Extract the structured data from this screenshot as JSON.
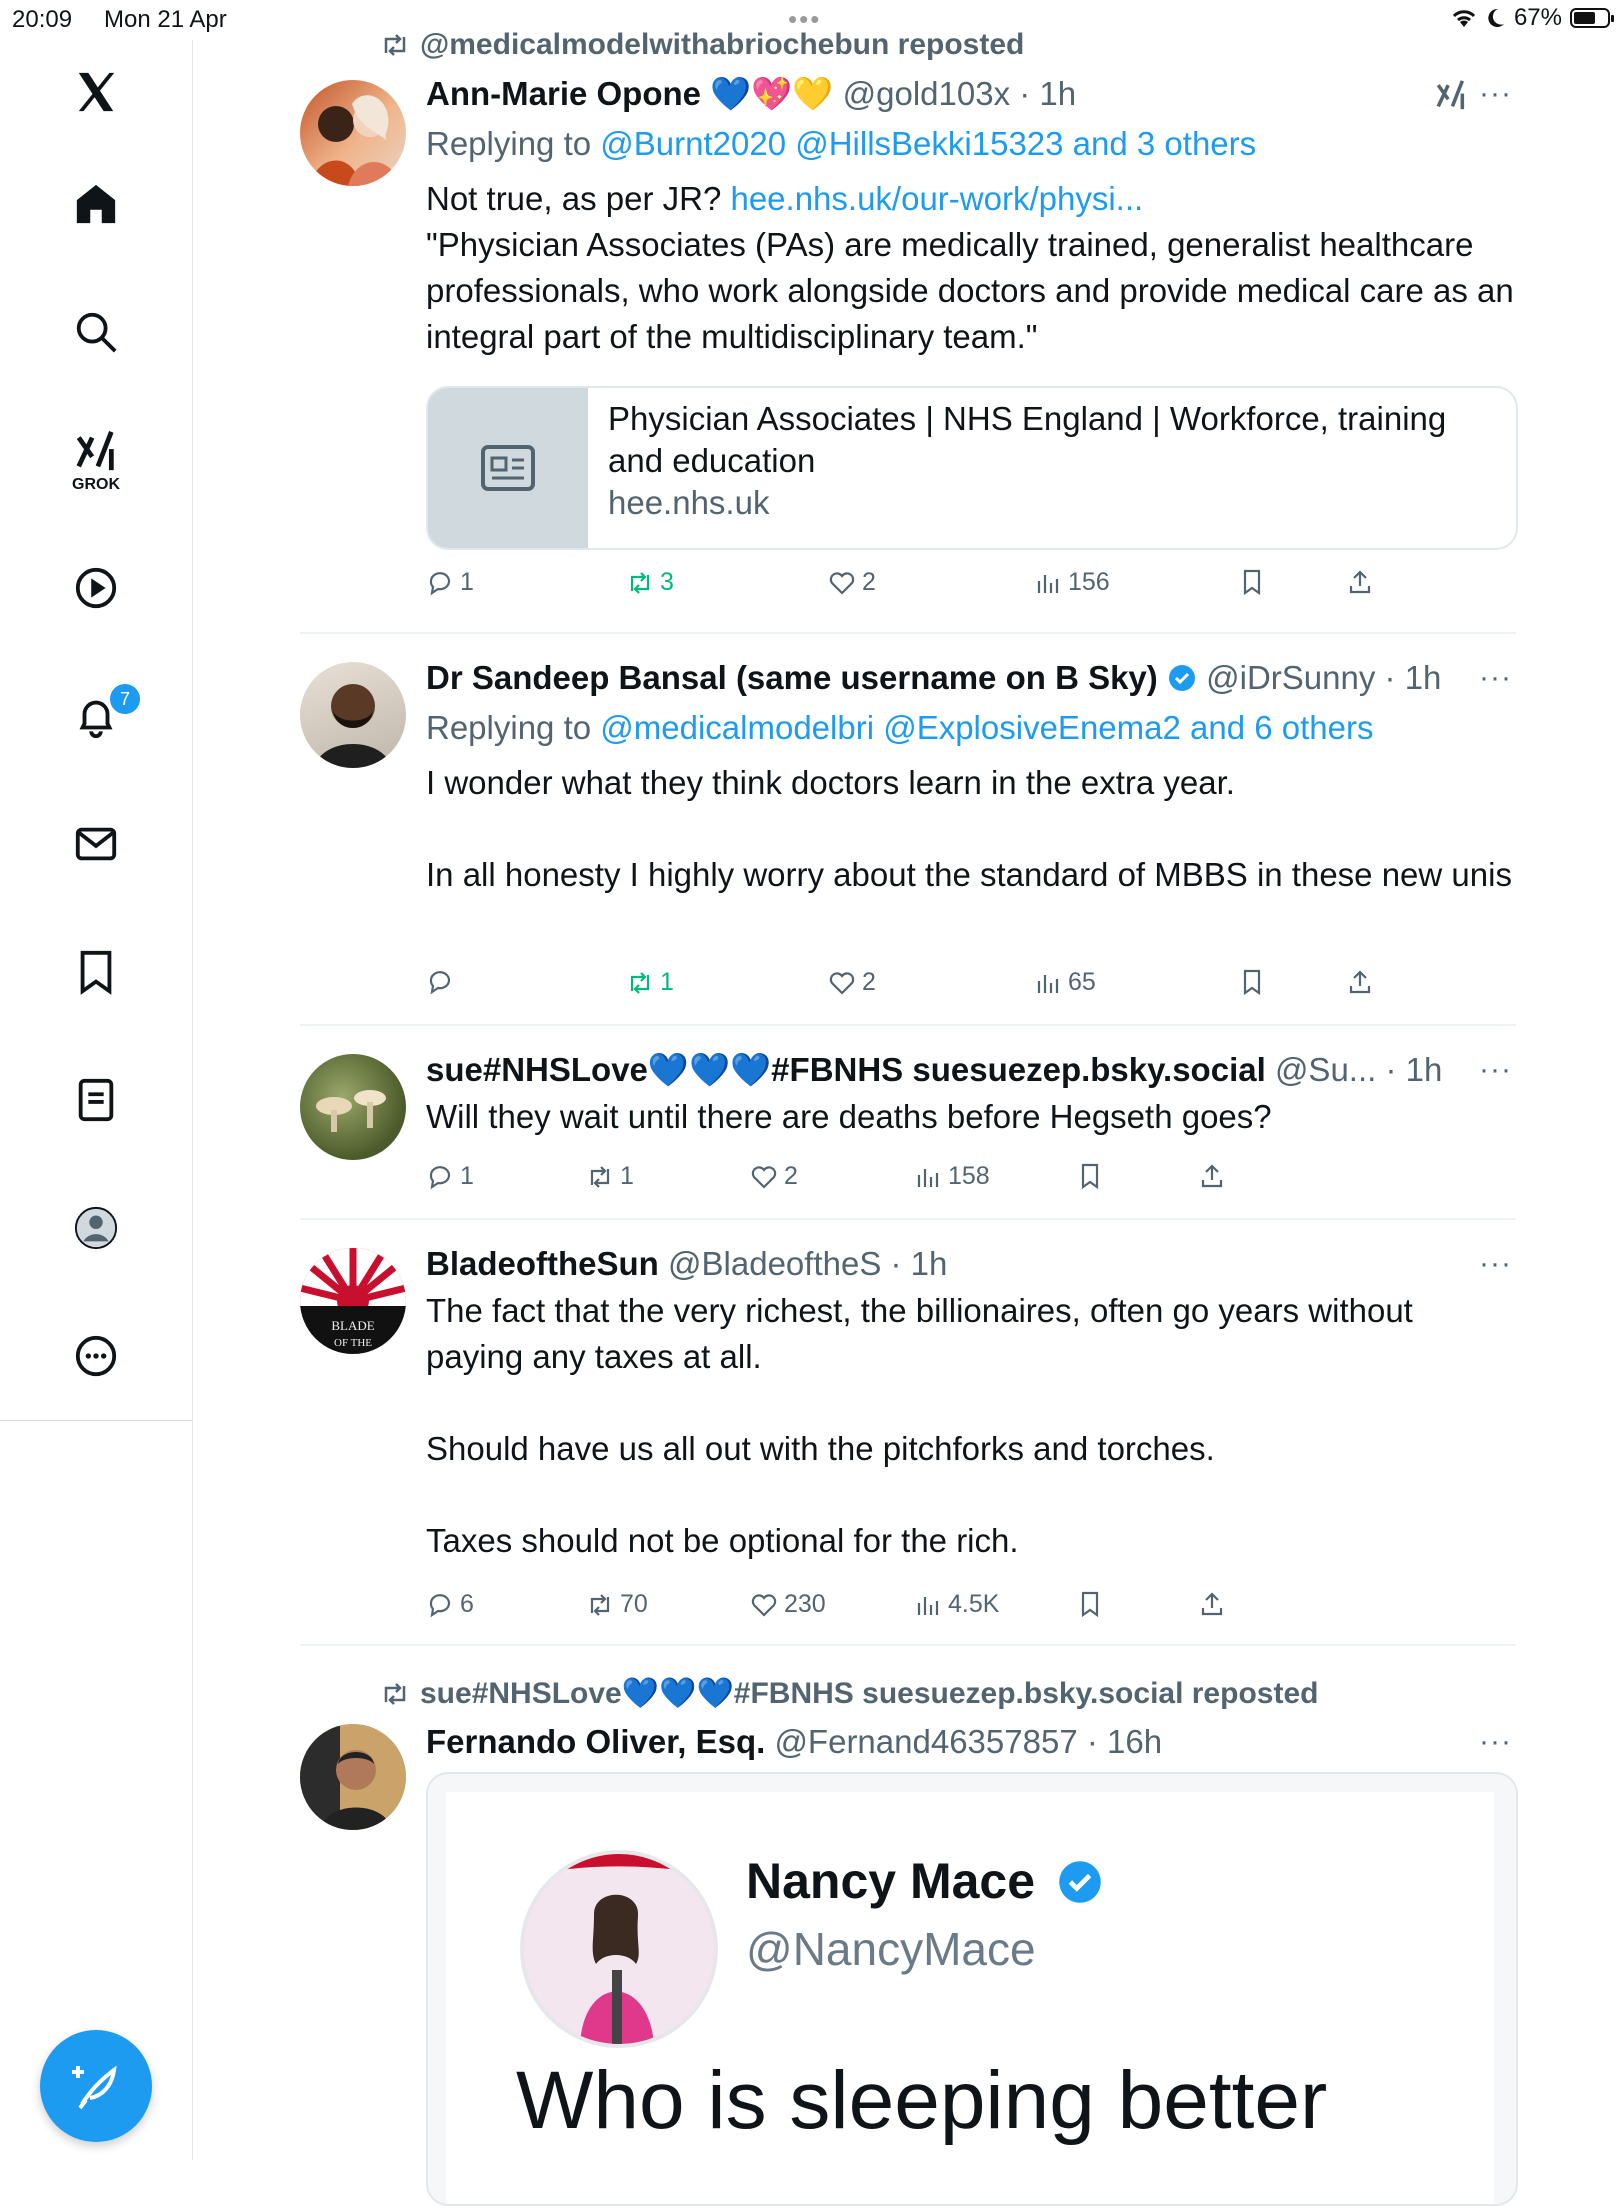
{
  "status_bar": {
    "time": "20:09",
    "date": "Mon 21 Apr",
    "battery": "67%",
    "battery_level": 0.67
  },
  "sidebar": {
    "items": [
      {
        "icon": "x-logo-icon"
      },
      {
        "icon": "home-icon"
      },
      {
        "icon": "search-icon"
      },
      {
        "icon": "grok-icon",
        "label": "GROK"
      },
      {
        "icon": "play-icon"
      },
      {
        "icon": "bell-icon",
        "badge": "7"
      },
      {
        "icon": "mail-icon"
      },
      {
        "icon": "bookmark-icon"
      },
      {
        "icon": "list-icon"
      },
      {
        "icon": "profile-icon"
      },
      {
        "icon": "more-icon"
      }
    ],
    "compose_icon": "compose-feather-icon"
  },
  "tweets": [
    {
      "repost_by": "@medicalmodelwithabriochebun reposted",
      "name": "Ann-Marie Opone 💙💖💛",
      "handle": "@gold103x",
      "time": "1h",
      "reply_prefix": "Replying to ",
      "reply_to": "@Burnt2020 @HillsBekki15323 and 3 others",
      "text_intro": "Not true, as per JR? ",
      "link": "hee.nhs.uk/our-work/physi...",
      "quote": "\"Physician Associates (PAs) are medically trained, generalist healthcare professionals, who work alongside doctors and provide medical care as an integral part of the multidisciplinary team.\"",
      "card": {
        "title": "Physician Associates | NHS England | Workforce, training and education",
        "domain": "hee.nhs.uk"
      },
      "replies": "1",
      "reposts": "3",
      "likes": "2",
      "views": "156"
    },
    {
      "name": "Dr Sandeep Bansal (same username on B Sky)",
      "handle": "@iDrSunny",
      "time": "1h",
      "reply_prefix": "Replying to ",
      "reply_to": "@medicalmodelbri @ExplosiveEnema2 and 6 others",
      "para1": "I wonder what they think doctors learn in the extra year.",
      "para2": "In all honesty I highly worry about the standard of MBBS in these new unis",
      "replies": "",
      "reposts": "1",
      "likes": "2",
      "views": "65"
    },
    {
      "name": "sue#NHSLove💙💙💙#FBNHS suesuezep.bsky.social",
      "handle": "@Su...",
      "time": "1h",
      "text": "Will they wait until there are deaths before Hegseth goes?",
      "replies": "1",
      "reposts": "1",
      "likes": "2",
      "views": "158"
    },
    {
      "name": "BladeoftheSun",
      "handle": "@BladeoftheS",
      "time": "1h",
      "para1": "The fact that the very richest, the billionaires, often go years without paying any taxes at all.",
      "para2": "Should have us all out with the pitchforks and torches.",
      "para3": "Taxes should not be optional for the rich.",
      "replies": "6",
      "reposts": "70",
      "likes": "230",
      "views": "4.5K"
    },
    {
      "repost_by": "sue#NHSLove💙💙💙#FBNHS suesuezep.bsky.social reposted",
      "name": "Fernando Oliver, Esq.",
      "handle": "@Fernand46357857",
      "time": "16h",
      "media": {
        "name": "Nancy Mace",
        "handle": "@NancyMace",
        "text": "Who is sleeping better"
      }
    }
  ],
  "colors": {
    "accent": "#1d9bf0",
    "repost_green": "#00ba7c",
    "secondary": "#536471"
  }
}
